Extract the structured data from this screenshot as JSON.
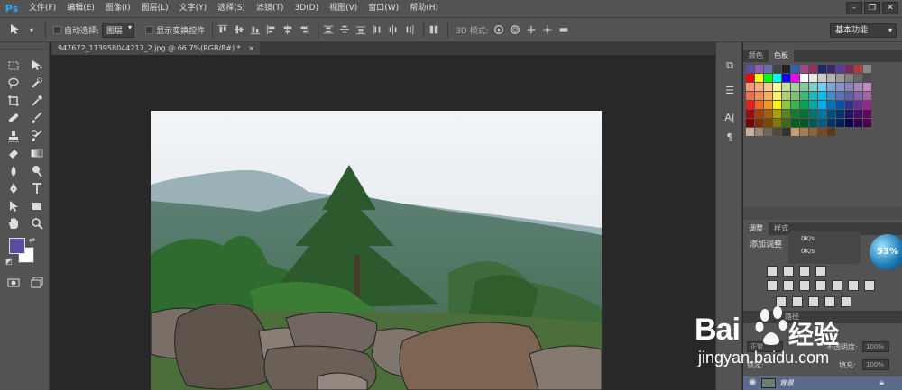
{
  "app": {
    "logo": "Ps"
  },
  "menu": [
    "文件(F)",
    "编辑(E)",
    "图像(I)",
    "图层(L)",
    "文字(Y)",
    "选择(S)",
    "滤镜(T)",
    "3D(D)",
    "视图(V)",
    "窗口(W)",
    "帮助(H)"
  ],
  "window_controls": {
    "minimize": "–",
    "restore": "❐",
    "close": "✕"
  },
  "options": {
    "auto_select_label": "自动选择:",
    "auto_select_value": "图层",
    "show_transform_label": "显示变换控件",
    "mode_3d_label": "3D 模式:",
    "workspace": "基本功能"
  },
  "document": {
    "tab_title": "947672_113958044217_2.jpg @ 66.7%(RGB/8#) *",
    "close_glyph": "×"
  },
  "panels": {
    "color_tab": "颜色",
    "swatches_tab": "色板",
    "adjustments_tab": "调整",
    "styles_tab": "样式",
    "add_adjustment_label": "添加调整",
    "layers_blend_mode": "正常",
    "layers_opacity_label": "不透明度:",
    "layers_opacity_value": "100%",
    "layers_lock_label": "锁定:",
    "layers_fill_label": "填充:",
    "layers_fill_value": "100%",
    "paths_tab": "路径",
    "layer_name": "背景"
  },
  "speed_widget": {
    "up": "0K/s",
    "down": "0K/s",
    "badge": "53%"
  },
  "watermark": {
    "brand_left": "Bai",
    "brand_right": "经验",
    "url": "jingyan.baidu.com"
  },
  "colors": {
    "foreground": "#5a4ca0",
    "background": "#ffffff",
    "ui_panel": "#535353",
    "ui_dark": "#282828",
    "ps_logo": "#31a8ff"
  },
  "swatch_colors": [
    "#5b4ea3",
    "#8a5db0",
    "#6b6bb3",
    "#444",
    "#222",
    "#3060b0",
    "#a04880",
    "#903060",
    "#1c2a6c",
    "#3a2a6c",
    "#5a3a9a",
    "#7a2a5a",
    "#b03a3a",
    "#888",
    "#ff0000",
    "#ffff00",
    "#00ff00",
    "#00ffff",
    "#0000ff",
    "#ff00ff",
    "#ffffff",
    "#e6e6e6",
    "#cccccc",
    "#b3b3b3",
    "#999999",
    "#808080",
    "#666666",
    "#4d4d4d",
    "#f7977a",
    "#f9ad81",
    "#fdc68a",
    "#fff79a",
    "#c4df9b",
    "#a2d39c",
    "#82ca9d",
    "#7bcdc8",
    "#6ecff6",
    "#7ea7d8",
    "#8493ca",
    "#8882be",
    "#a187be",
    "#bc8dbf",
    "#f26c4f",
    "#f68e55",
    "#fbaf5c",
    "#fff467",
    "#acd372",
    "#7cc576",
    "#3bb878",
    "#1abbb4",
    "#00bff3",
    "#438ccb",
    "#5574b9",
    "#605ca8",
    "#855fa8",
    "#a763a8",
    "#ed1c24",
    "#f26522",
    "#f7941d",
    "#fff200",
    "#8dc73f",
    "#39b54a",
    "#00a651",
    "#00a99d",
    "#00aeef",
    "#0072bc",
    "#0054a6",
    "#2e3192",
    "#662d91",
    "#92278f",
    "#9e0b0f",
    "#a0410d",
    "#a3620a",
    "#aba000",
    "#598527",
    "#1a7b30",
    "#007236",
    "#00746b",
    "#0076a3",
    "#004b80",
    "#003471",
    "#1b1464",
    "#440e62",
    "#630460",
    "#790000",
    "#7b2e00",
    "#7d4900",
    "#827b00",
    "#406618",
    "#005e20",
    "#005826",
    "#005952",
    "#005b7f",
    "#003663",
    "#002157",
    "#0d004c",
    "#32004b",
    "#4b0049",
    "#c7b299",
    "#998675",
    "#736357",
    "#534741",
    "#37302d",
    "#c69c6d",
    "#a67c52",
    "#8c6239",
    "#754c24",
    "#603913"
  ]
}
